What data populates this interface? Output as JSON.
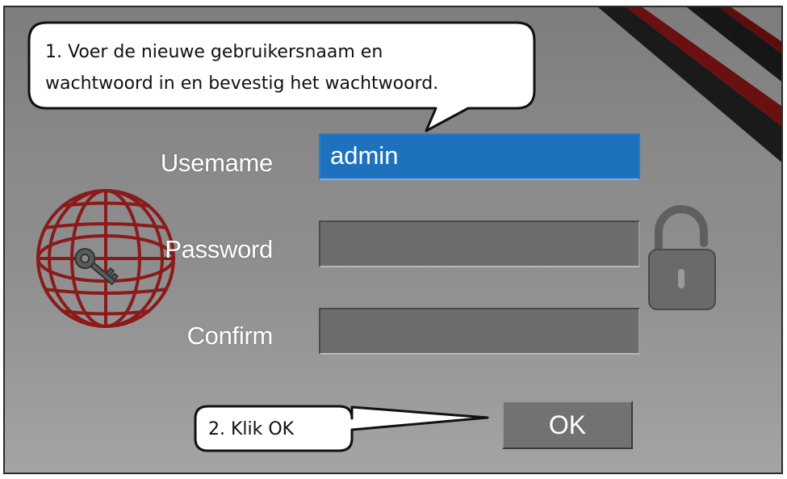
{
  "form": {
    "username_label": "Usemame",
    "username_value": "admin",
    "password_label": "Password",
    "password_value": "",
    "confirm_label": "Confirm",
    "confirm_value": "",
    "ok_label": "OK"
  },
  "callouts": {
    "step1_line1": "1. Voer de nieuwe gebruikersnaam en",
    "step1_line2": "wachtwoord in en bevestig het wachtwoord.",
    "step2": "2. Klik OK"
  },
  "icons": {
    "globe": "globe-key-icon",
    "lock": "padlock-open-icon"
  },
  "colors": {
    "active_field": "#1e72bd",
    "accent_red": "#8b1a1a"
  }
}
